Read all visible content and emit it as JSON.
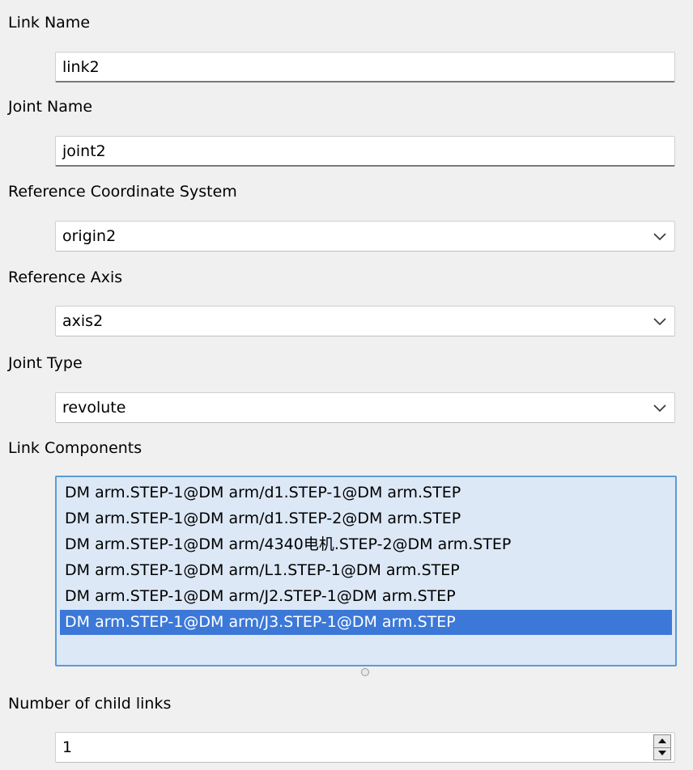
{
  "link_name": {
    "label": "Link Name",
    "value": "link2"
  },
  "joint_name": {
    "label": "Joint Name",
    "value": "joint2"
  },
  "reference_coordinate_system": {
    "label": "Reference Coordinate System",
    "selected": "origin2",
    "icon": "chevron-down-icon"
  },
  "reference_axis": {
    "label": "Reference Axis",
    "selected": "axis2",
    "icon": "chevron-down-icon"
  },
  "joint_type": {
    "label": "Joint Type",
    "selected": "revolute",
    "icon": "chevron-down-icon"
  },
  "link_components": {
    "label": "Link Components",
    "items": [
      "DM arm.STEP-1@DM arm/d1.STEP-1@DM arm.STEP",
      "DM arm.STEP-1@DM arm/d1.STEP-2@DM arm.STEP",
      "DM arm.STEP-1@DM arm/4340电机.STEP-2@DM arm.STEP",
      "DM arm.STEP-1@DM arm/L1.STEP-1@DM arm.STEP",
      "DM arm.STEP-1@DM arm/J2.STEP-1@DM arm.STEP",
      "DM arm.STEP-1@DM arm/J3.STEP-1@DM arm.STEP"
    ],
    "selected_index": 5
  },
  "number_of_child_links": {
    "label": "Number of child links",
    "value": "1",
    "icons": [
      "spin-up-icon",
      "spin-down-icon"
    ]
  },
  "colors": {
    "background": "#f0f0f0",
    "list_background": "#dce8f6",
    "list_border": "#5b9bd5",
    "selection": "#3c78d8"
  }
}
